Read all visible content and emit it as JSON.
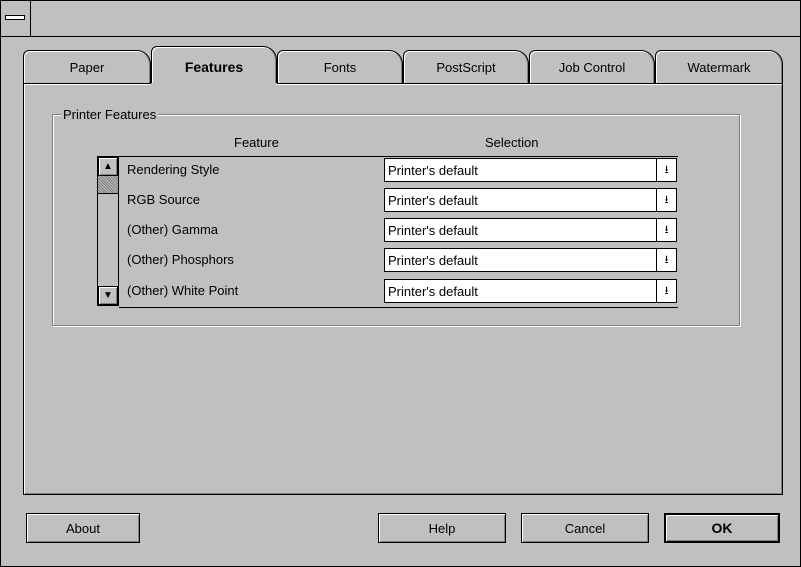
{
  "window": {
    "sysmenu_icon": "system-menu-icon"
  },
  "tabs": [
    {
      "label": "Paper",
      "active": false
    },
    {
      "label": "Features",
      "active": true
    },
    {
      "label": "Fonts",
      "active": false
    },
    {
      "label": "PostScript",
      "active": false
    },
    {
      "label": "Job Control",
      "active": false
    },
    {
      "label": "Watermark",
      "active": false
    }
  ],
  "group": {
    "label": "Printer Features",
    "feature_header": "Feature",
    "selection_header": "Selection"
  },
  "features": [
    {
      "name": "Rendering Style",
      "selection": "Printer's default"
    },
    {
      "name": "RGB Source",
      "selection": "Printer's default"
    },
    {
      "name": "(Other) Gamma",
      "selection": "Printer's default"
    },
    {
      "name": "(Other) Phosphors",
      "selection": "Printer's default"
    },
    {
      "name": "(Other) White Point",
      "selection": "Printer's default"
    }
  ],
  "buttons": {
    "about": "About",
    "help": "Help",
    "cancel": "Cancel",
    "ok": "OK"
  }
}
